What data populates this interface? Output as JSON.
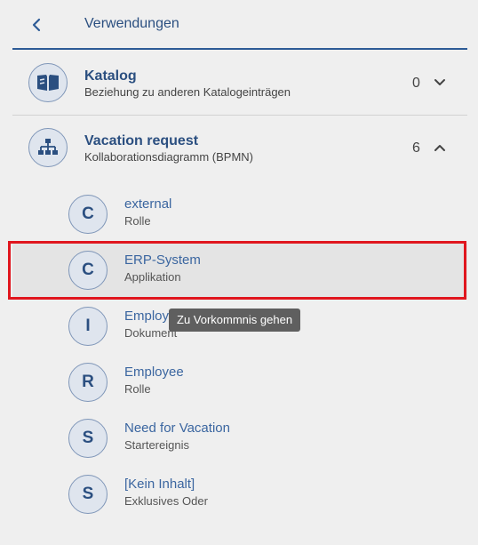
{
  "header": {
    "title": "Verwendungen"
  },
  "groups": [
    {
      "title": "Katalog",
      "subtitle": "Beziehung zu anderen Katalogeinträgen",
      "count": "0",
      "expanded": false,
      "icon": "book-open-icon"
    },
    {
      "title": "Vacation request",
      "subtitle": "Kollaborationsdiagramm (BPMN)",
      "count": "6",
      "expanded": true,
      "icon": "org-chart-icon"
    }
  ],
  "items": [
    {
      "letter": "C",
      "title": "external",
      "subtitle": "Rolle"
    },
    {
      "letter": "C",
      "title": "ERP-System",
      "subtitle": "Applikation",
      "selected": true
    },
    {
      "letter": "I",
      "title": "Employ",
      "subtitle": "Dokument"
    },
    {
      "letter": "R",
      "title": "Employee",
      "subtitle": "Rolle"
    },
    {
      "letter": "S",
      "title": "Need for Vacation",
      "subtitle": "Startereignis"
    },
    {
      "letter": "S",
      "title": "[Kein Inhalt]",
      "subtitle": "Exklusives Oder"
    }
  ],
  "tooltip": "Zu Vorkommnis gehen",
  "colors": {
    "accent": "#2d5b96",
    "highlight": "#e0161e",
    "background": "#efefef"
  }
}
